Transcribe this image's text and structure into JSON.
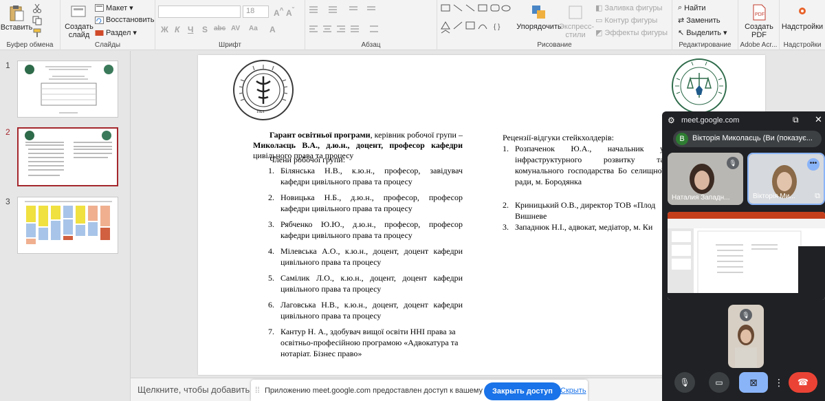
{
  "ribbon": {
    "clipboard": {
      "paste": "Вставить",
      "title": "Буфер обмена"
    },
    "slides": {
      "new_slide": "Создать слайд",
      "layout": "Макет",
      "reset": "Восстановить",
      "section": "Раздел",
      "title": "Слайды"
    },
    "font": {
      "title": "Шрифт",
      "size": "18",
      "buttons": [
        "Ж",
        "К",
        "Ч",
        "S",
        "abc",
        "AV",
        "Aa",
        "A"
      ]
    },
    "paragraph": {
      "title": "Абзац"
    },
    "drawing": {
      "arrange": "Упорядочить",
      "quick_styles": "Экспресс-стили",
      "fill": "Заливка фигуры",
      "outline": "Контур фигуры",
      "effects": "Эффекты фигуры",
      "title": "Рисование"
    },
    "editing": {
      "find": "Найти",
      "replace": "Заменить",
      "select": "Выделить",
      "title": "Редактирование"
    },
    "pdf": {
      "create": "Создать PDF",
      "title": "Adobe Acr..."
    },
    "addins": {
      "label": "Надстройки",
      "title": "Надстройки"
    }
  },
  "thumbnails": [
    {
      "num": "1"
    },
    {
      "num": "2"
    },
    {
      "num": "3"
    }
  ],
  "slide": {
    "seal_year": "1921",
    "guarantor_bold": "Гарант освітньої програми",
    "guarantor_rest": ", керівник робочої групи –",
    "guarantor_name": "Миколаєць В.А., д.ю.н., доцент, професор кафедри",
    "guarantor_tail": "цивільного права та процесу",
    "members_title": "Члени робочої групи:",
    "members": [
      {
        "n": "1.",
        "text": "Білянська Н.В., к.ю.н., професор, завідувач кафедри цивільного права та процесу"
      },
      {
        "n": "2.",
        "text": "Новицька Н.Б., д.ю.н., професор, професор кафедри цивільного права та процесу"
      },
      {
        "n": "3.",
        "text": "Рябченко Ю.Ю., д.ю.н., професор, професор кафедри цивільного права та процесу"
      },
      {
        "n": "4.",
        "text": "Мілевська А.О., к.ю.н., доцент, доцент кафедри цивільного права та процесу"
      },
      {
        "n": "5.",
        "text": "Самілик Л.О., к.ю.н., доцент, доцент кафедри цивільного права та процесу"
      },
      {
        "n": "6.",
        "text": "Лаговська Н.В., к.ю.н., доцент, доцент кафедри цивільного права та процесу"
      },
      {
        "n": "7.",
        "text": "Кантур Н. А., здобувач вищої освіти ННІ права за освітньо-професійною програмою «Адвокатура та нотаріат. Бізнес право»"
      }
    ],
    "reviews_title": "Рецензії-відгуки стейкхолдерів:",
    "reviews": [
      {
        "n": "1.",
        "text": "Розпаченок Ю.А., начальник у інфраструктурного розвитку та комунального господарства Бо селищної ради, м. Бородянка"
      },
      {
        "n": "2.",
        "text": "Криницький О.В., директор ТОВ «Плод Вишневе"
      },
      {
        "n": "3.",
        "text": "Западнюк Н.І., адвокат, медіатор, м. Ки"
      }
    ]
  },
  "notes": {
    "placeholder": "Щелкните, чтобы добавить зам"
  },
  "share_bar": {
    "message": "Приложению meet.google.com предоставлен доступ к вашему экрану.",
    "stop": "Закрыть доступ",
    "hide": "Скрыть"
  },
  "meet": {
    "url": "meet.google.com",
    "presenter": "Вікторія Миколаєць (Ви (показує...",
    "avatar_letter": "В",
    "tile1_name": "Наталия Западн...",
    "tile2_name": "Вікторія Ми..."
  }
}
